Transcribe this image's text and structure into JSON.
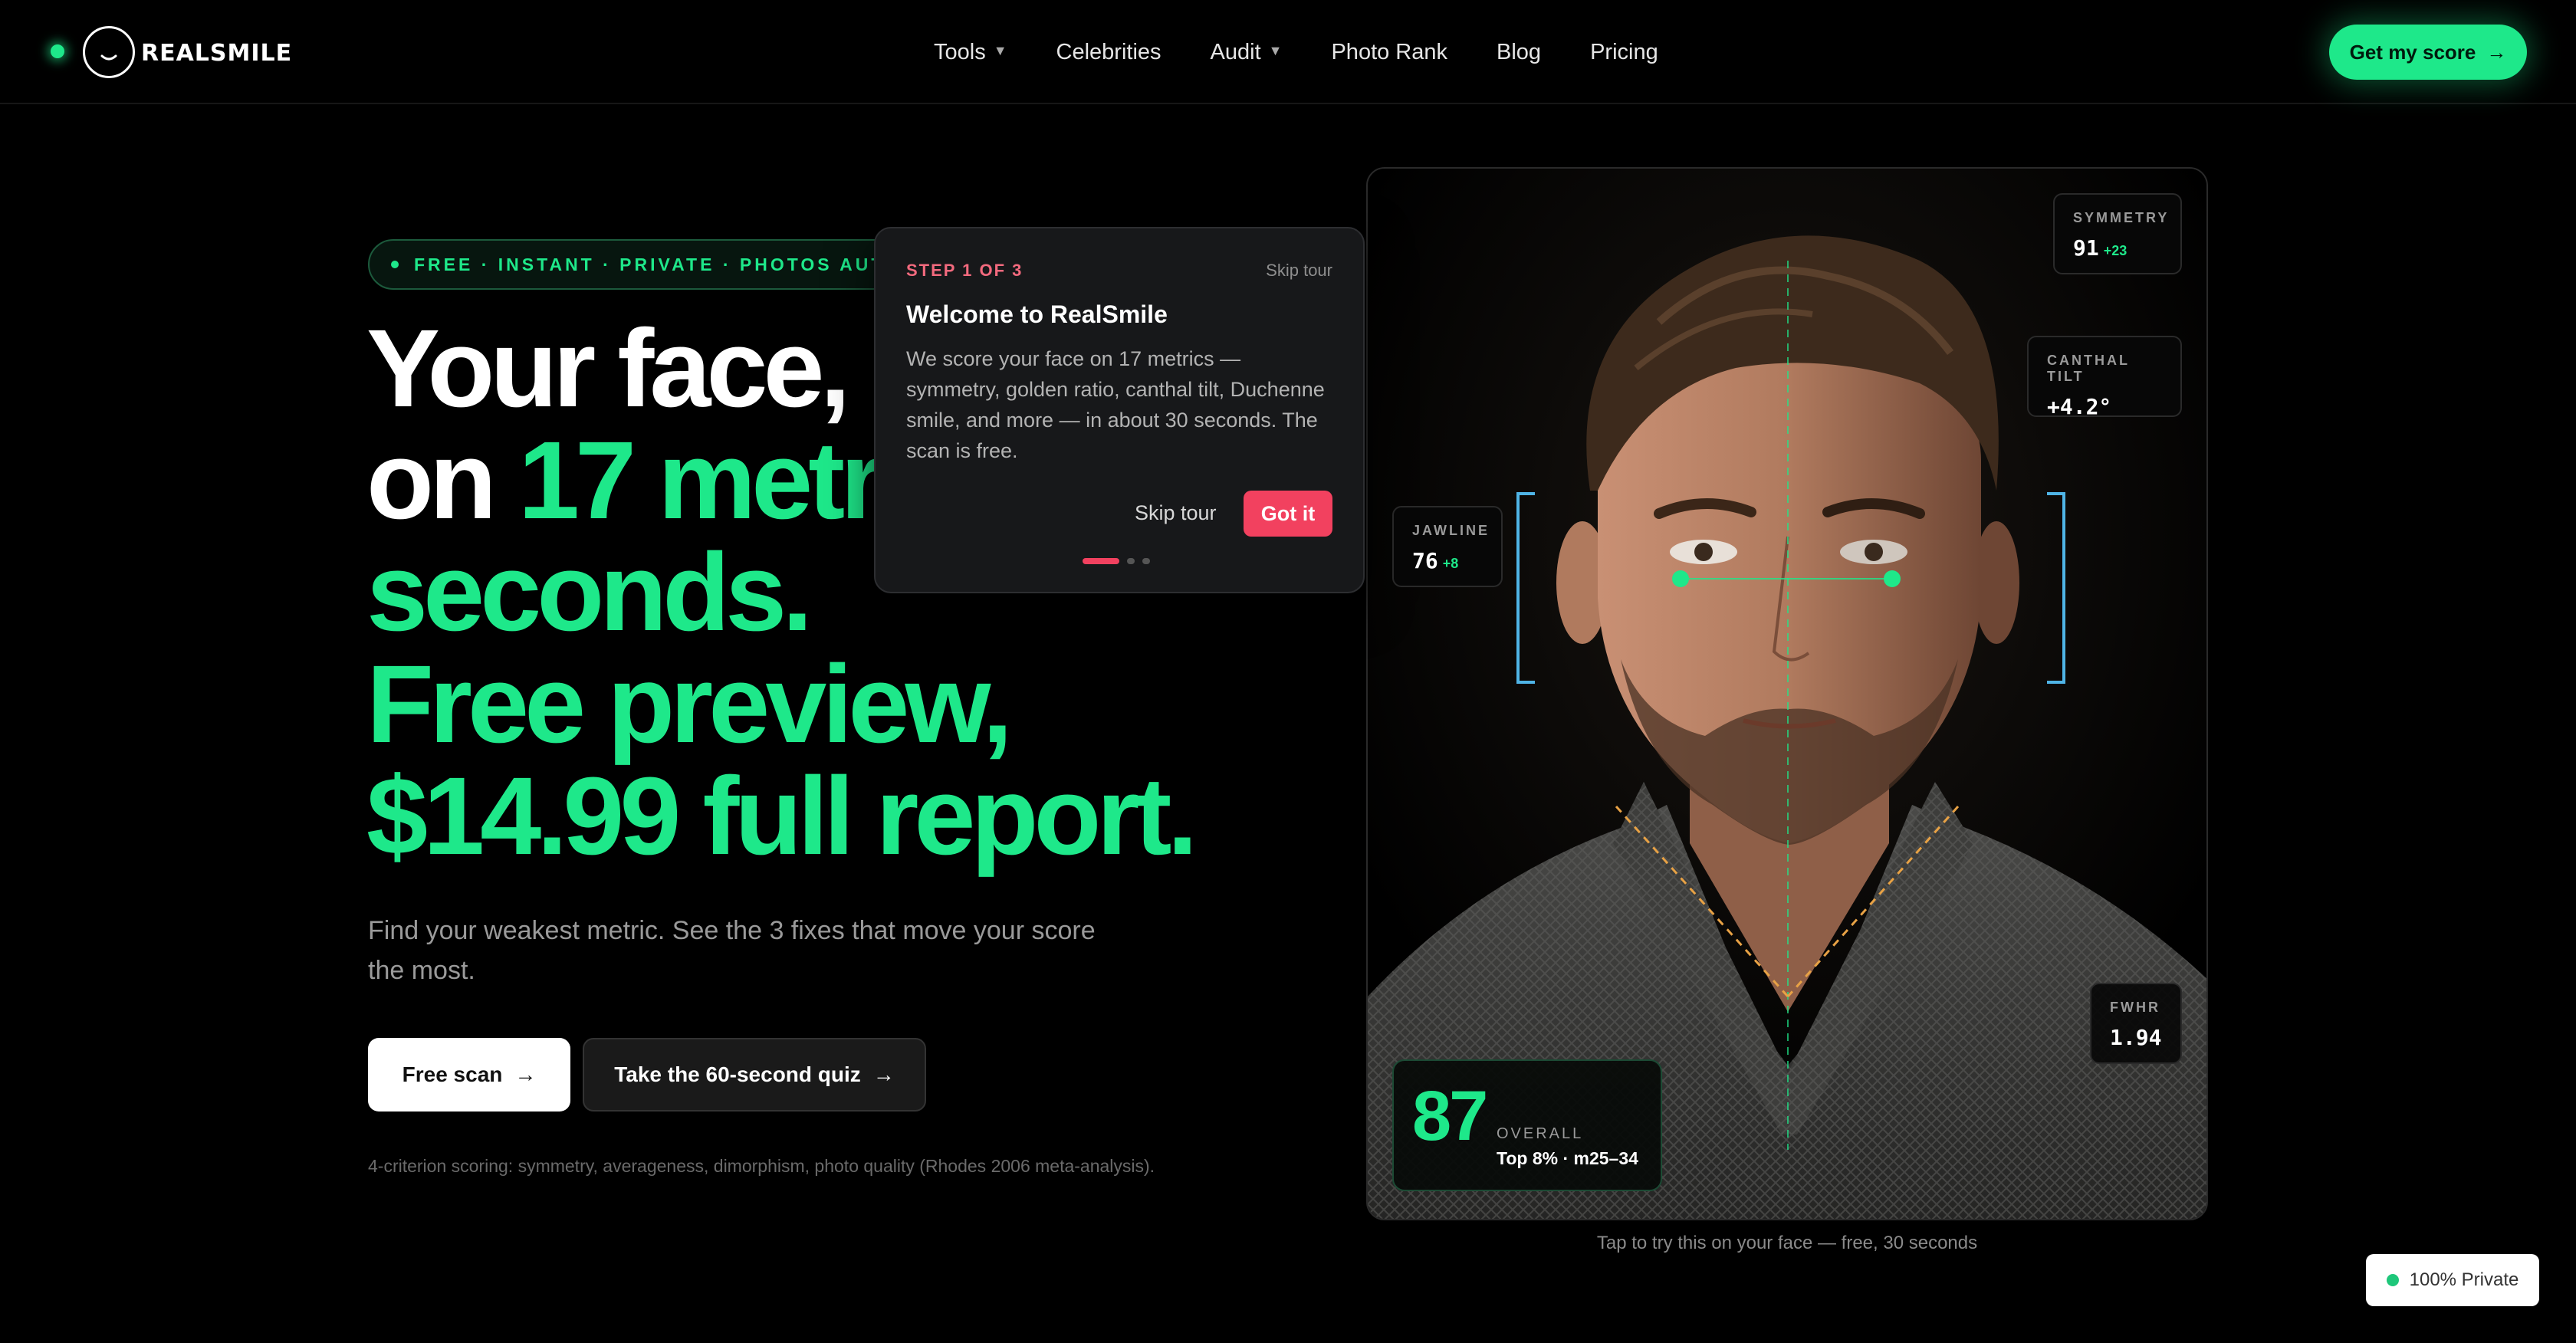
{
  "brand": {
    "name": "REALSMILE"
  },
  "nav": {
    "links": [
      {
        "label": "Tools",
        "dropdown": true
      },
      {
        "label": "Celebrities",
        "dropdown": false
      },
      {
        "label": "Audit",
        "dropdown": true
      },
      {
        "label": "Photo Rank",
        "dropdown": false
      },
      {
        "label": "Blog",
        "dropdown": false
      },
      {
        "label": "Pricing",
        "dropdown": false
      }
    ],
    "cta": "Get my score",
    "caret": "▼",
    "arrow": "→"
  },
  "hero": {
    "pill": "FREE · INSTANT · PRIVATE · PHOTOS AUTO-DE",
    "headline": {
      "l1": "Your face,",
      "l2a": "on ",
      "l2b": "17 metr",
      "l3": "seconds.",
      "l4": "Free preview,",
      "l5": "$14.99 full report."
    },
    "subtext": "Find your weakest metric. See the 3 fixes that move your score the most.",
    "btn_free": "Free scan",
    "btn_quiz": "Take the 60-second quiz",
    "arrow": "→",
    "footnote": "4-criterion scoring: symmetry, averageness, dimorphism, photo quality (Rhodes 2006 meta-analysis)."
  },
  "tour": {
    "step": "STEP 1 OF 3",
    "skip": "Skip tour",
    "title": "Welcome to RealSmile",
    "body": "We score your face on 17 metrics — symmetry, golden ratio, canthal tilt, Duchenne smile, and more — in about 30 seconds. The scan is free.",
    "got_it": "Got it"
  },
  "metrics": {
    "symmetry": {
      "label": "SYMMETRY",
      "value": "91",
      "delta": "+23"
    },
    "canthal": {
      "label": "CANTHAL TILT",
      "value": "+4.2°"
    },
    "jawline": {
      "label": "JAWLINE",
      "value": "76",
      "delta": "+8"
    },
    "fwhr": {
      "label": "FWHR",
      "value": "1.94"
    },
    "overall": {
      "value": "87",
      "label": "OVERALL",
      "rank": "Top 8% · m25–34"
    }
  },
  "caption": "Tap to try this on your face — free, 30 seconds",
  "privacy": "100% Private",
  "colors": {
    "accent": "#1ee88a",
    "tour_accent": "#f2415f",
    "background": "#000000"
  }
}
